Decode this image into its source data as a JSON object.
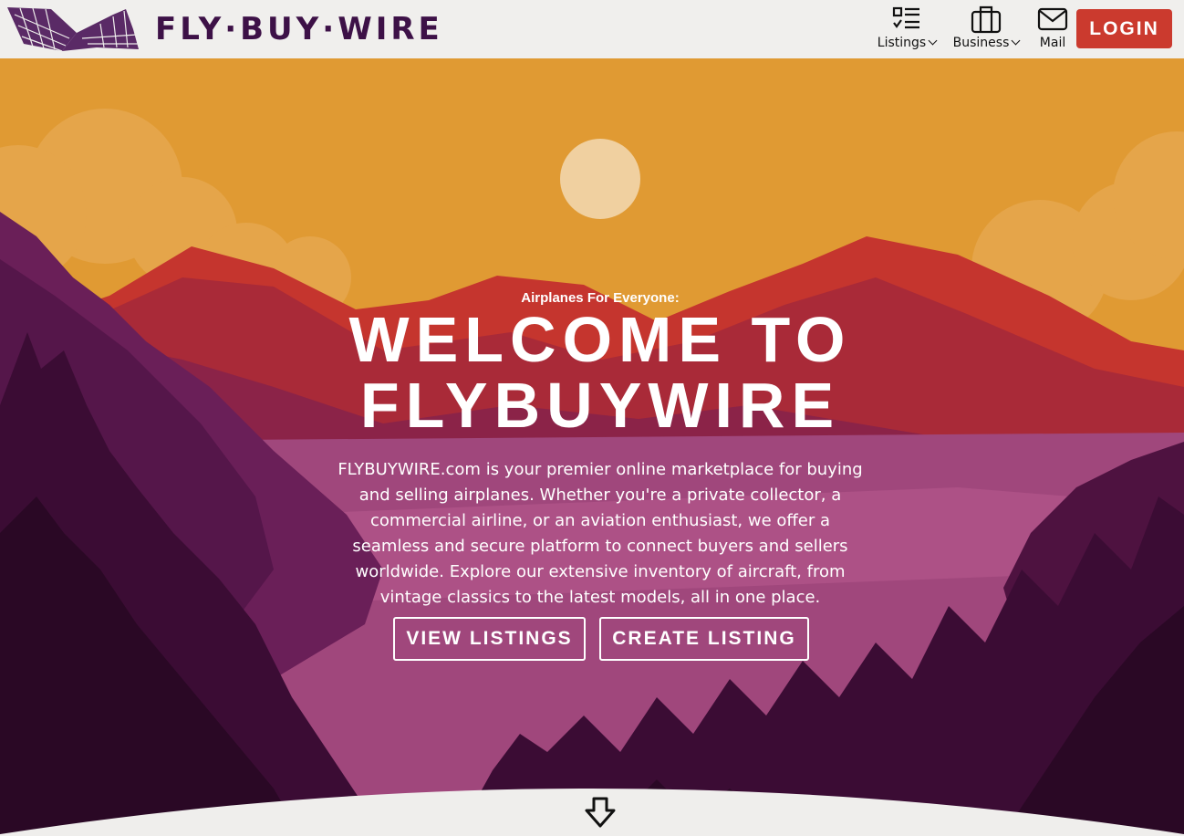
{
  "header": {
    "brand": "FLY·BUY·WIRE",
    "nav": [
      {
        "label": "Listings",
        "icon": "list-checklist-icon",
        "has_dropdown": true
      },
      {
        "label": "Business",
        "icon": "briefcase-icon",
        "has_dropdown": true
      },
      {
        "label": "Mail",
        "icon": "mail-icon",
        "has_dropdown": false
      }
    ],
    "login_label": "LOGIN"
  },
  "hero": {
    "eyebrow": "Airplanes For Everyone:",
    "title_line1": "WELCOME TO",
    "title_line2": "FLYBUYWIRE",
    "description": "FLYBUYWIRE.com is your premier online marketplace for buying and selling airplanes. Whether you're a private collector, a commercial airline, or an aviation enthusiast, we offer a seamless and secure platform to connect buyers and sellers worldwide. Explore our extensive inventory of aircraft, from vintage classics to the latest models, all in one place.",
    "buttons": {
      "view_listings": "VIEW LISTINGS",
      "create_listing": "CREATE LISTING"
    },
    "scroll_icon": "arrow-down-icon"
  },
  "colors": {
    "brand_purple": "#3d1147",
    "login_red": "#cb3a2e",
    "sky": "#e09a33",
    "sun": "#f0d0a0",
    "header_bg": "#f0efed"
  }
}
